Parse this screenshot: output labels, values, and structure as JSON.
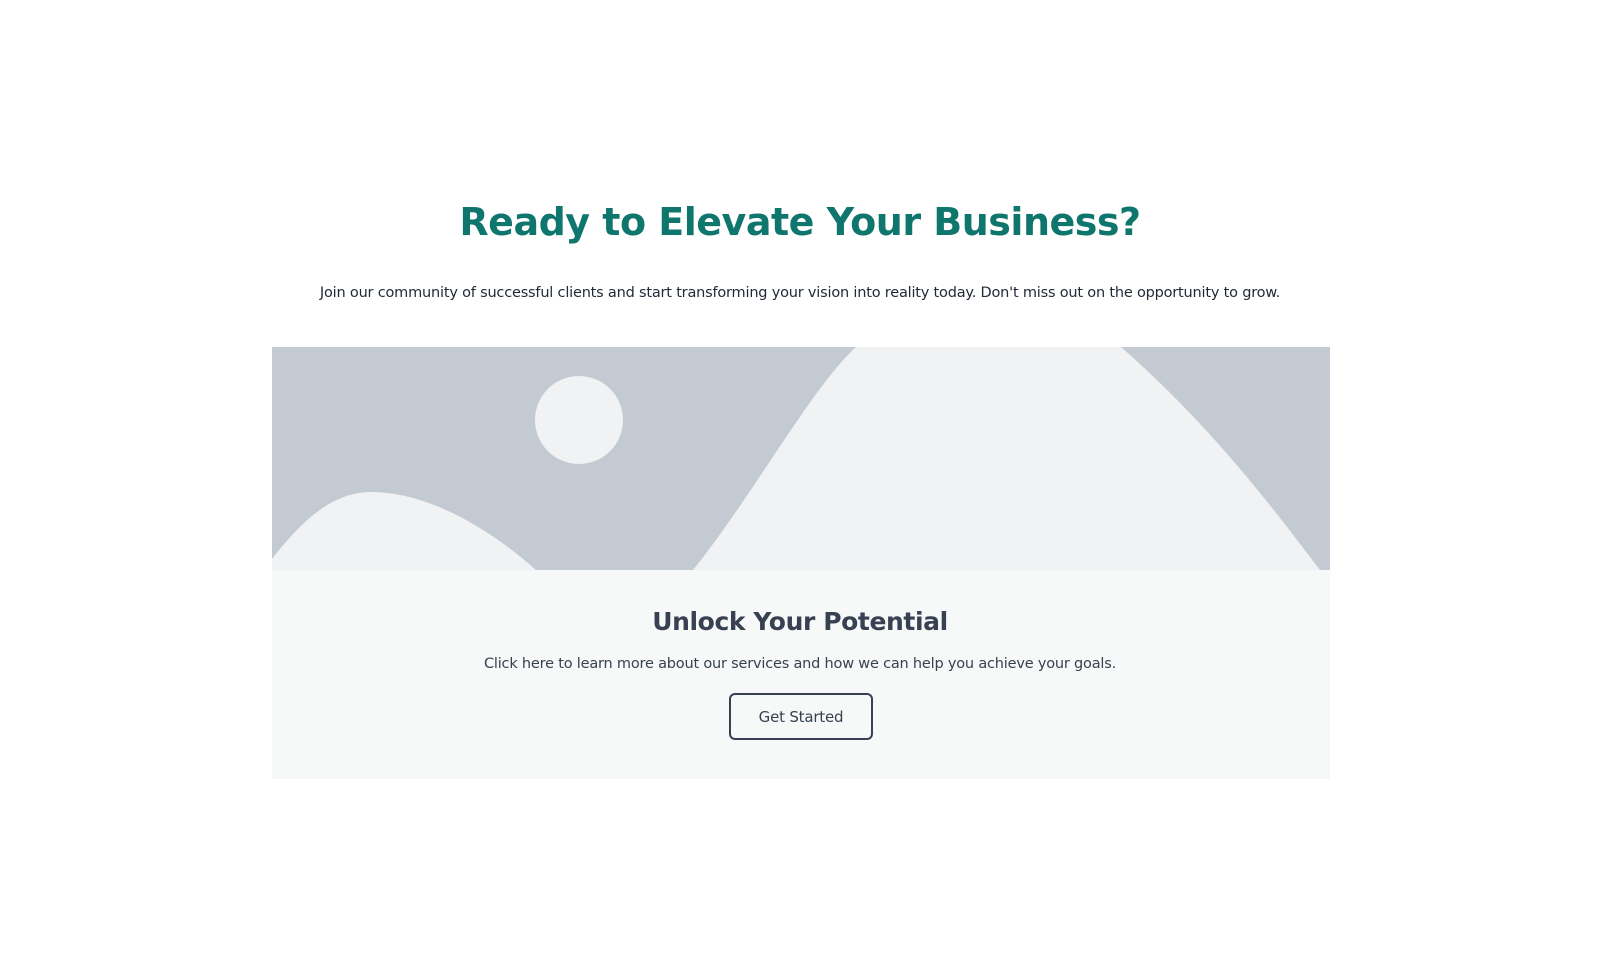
{
  "cta_section": {
    "heading": "Ready to Elevate Your Business?",
    "subtext": "Join our community of successful clients and start transforming your vision into reality today. Don't miss out on the opportunity to grow."
  },
  "card": {
    "image_icon": "placeholder-landscape-image",
    "title": "Unlock Your Potential",
    "description": "Click here to learn more about our services and how we can help you achieve your goals.",
    "button_label": "Get Started"
  },
  "colors": {
    "heading": "#0f766e",
    "body_text": "#1f2937",
    "card_text": "#374151",
    "card_background": "#f7f8f8",
    "image_background": "#c3cad1",
    "image_foreground": "#f1f2f3"
  }
}
